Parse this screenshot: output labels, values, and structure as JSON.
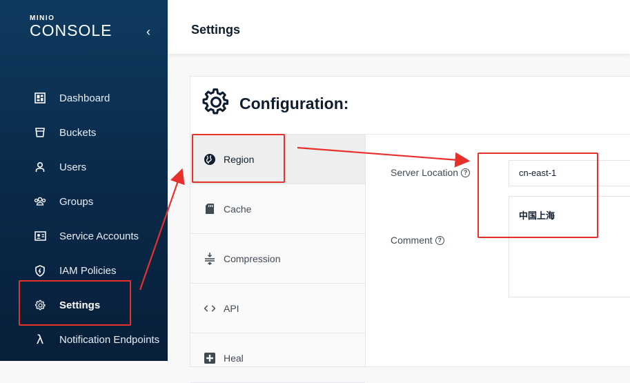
{
  "app": {
    "logo_small": "MINIO",
    "logo_big": "CONSOLE",
    "collapse_glyph": "‹"
  },
  "sidebar": {
    "items": [
      {
        "label": "Dashboard",
        "icon": "dashboard-icon"
      },
      {
        "label": "Buckets",
        "icon": "bucket-icon"
      },
      {
        "label": "Users",
        "icon": "user-icon"
      },
      {
        "label": "Groups",
        "icon": "groups-icon"
      },
      {
        "label": "Service Accounts",
        "icon": "service-accounts-icon"
      },
      {
        "label": "IAM Policies",
        "icon": "shield-icon"
      },
      {
        "label": "Settings",
        "icon": "gear-icon",
        "active": true
      },
      {
        "label": "Notification Endpoints",
        "icon": "lambda-icon"
      }
    ]
  },
  "header": {
    "title": "Settings"
  },
  "config": {
    "title": "Configuration:",
    "tabs": [
      {
        "label": "Region",
        "icon": "globe-icon",
        "active": true
      },
      {
        "label": "Cache",
        "icon": "sd-card-icon"
      },
      {
        "label": "Compression",
        "icon": "compress-icon"
      },
      {
        "label": "API",
        "icon": "code-icon"
      },
      {
        "label": "Heal",
        "icon": "plus-square-icon"
      }
    ],
    "fields": {
      "server_location_label": "Server Location",
      "server_location_value": "cn-east-1",
      "comment_label": "Comment",
      "comment_value": "中国上海"
    }
  },
  "colors": {
    "sidebar_top": "#0e3a5f",
    "sidebar_bottom": "#081f3a",
    "annotation_red": "#e8302a"
  }
}
